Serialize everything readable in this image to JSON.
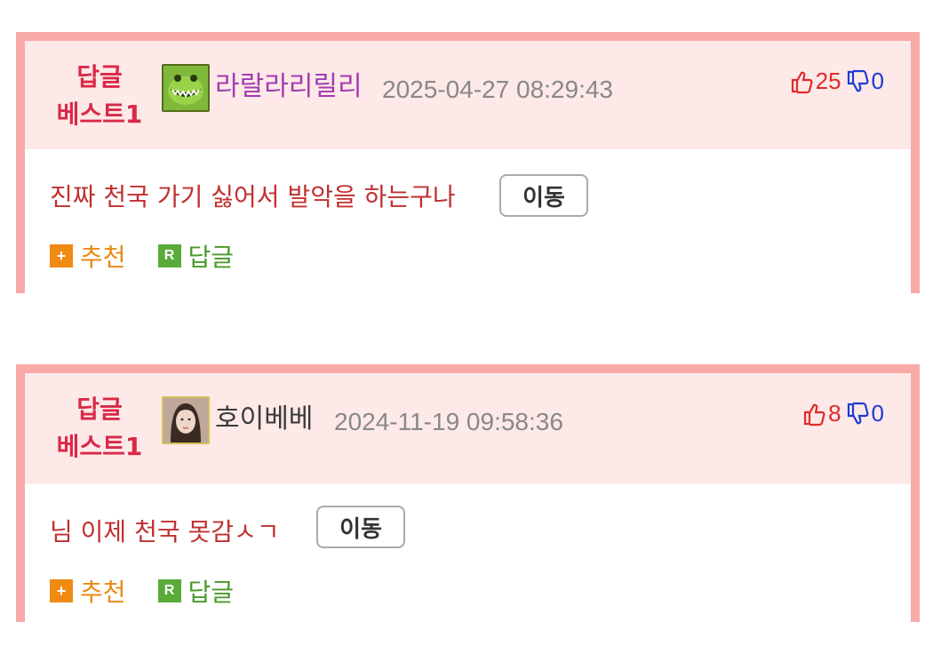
{
  "comments": [
    {
      "best_line1": "답글",
      "best_line2": "베스트1",
      "username": "라랄라리릴리",
      "datetime": "2025-04-27 08:29:43",
      "upvotes": "25",
      "downvotes": "0",
      "text": "진짜 천국 가기 싫어서 발악을 하는구나",
      "move_label": "이동",
      "recommend_label": "추천",
      "reply_label": "답글",
      "recommend_icon": "+",
      "reply_icon": "R"
    },
    {
      "best_line1": "답글",
      "best_line2": "베스트1",
      "username": "호이베베",
      "datetime": "2024-11-19 09:58:36",
      "upvotes": "8",
      "downvotes": "0",
      "text": "님 이제 천국 못감ㅅㄱ",
      "move_label": "이동",
      "recommend_label": "추천",
      "reply_label": "답글",
      "recommend_icon": "+",
      "reply_icon": "R"
    }
  ],
  "colors": {
    "border": "#f8aaa8",
    "header_bg": "#fde9e8",
    "best_text": "#d82a48",
    "content_text": "#c03030",
    "upvote": "#e02a2a",
    "downvote": "#1f3bd4",
    "recommend": "#e88a12",
    "reply": "#4a9a2a"
  }
}
